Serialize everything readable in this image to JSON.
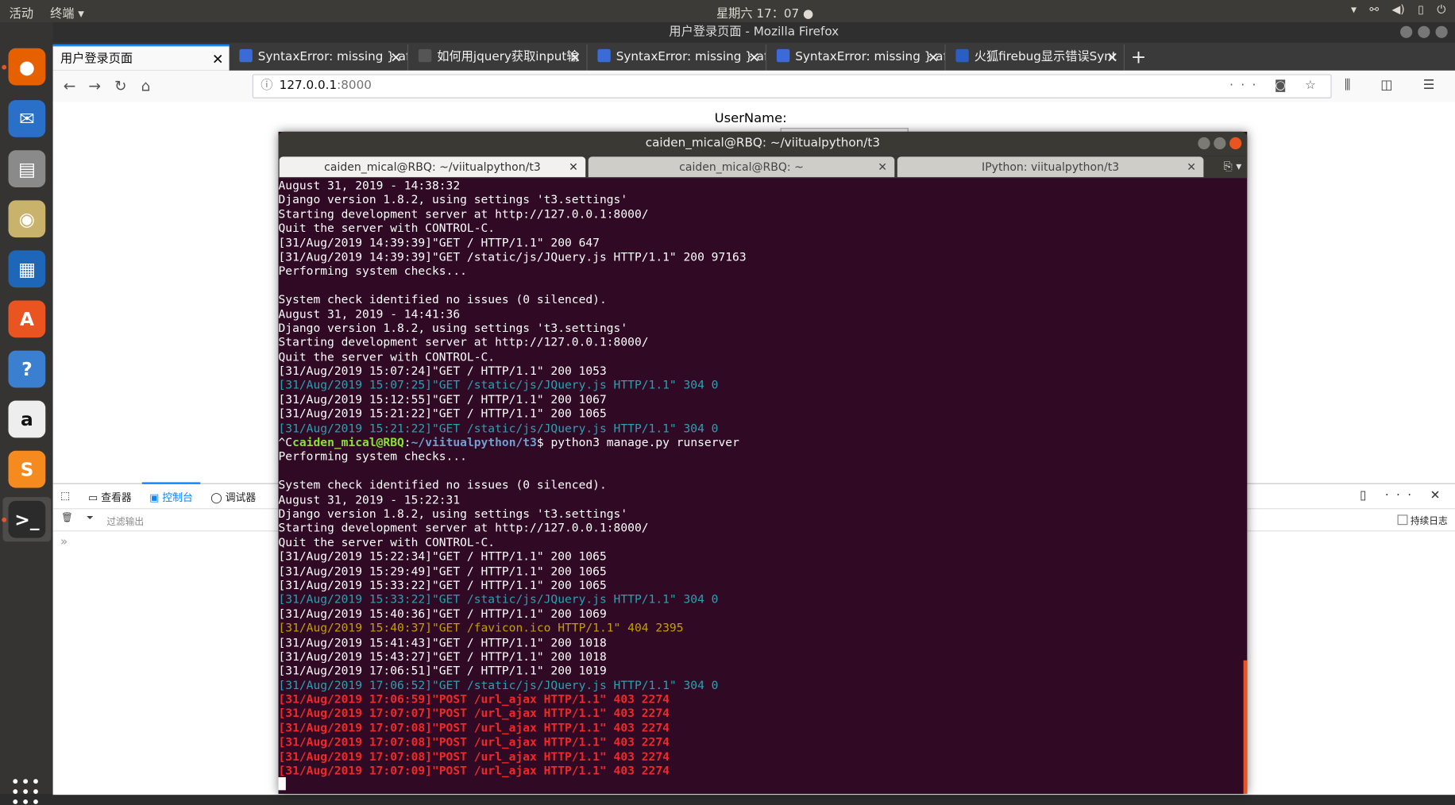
{
  "topbar": {
    "activities": "活动",
    "app_menu": "终端 ▾",
    "clock": "星期六 17：07 ●",
    "tray": [
      "▾",
      "⚯",
      "◀)",
      "▯",
      "⏻"
    ]
  },
  "firefox": {
    "window_title": "用户登录页面 - Mozilla Firefox",
    "tabs": [
      {
        "label": "用户登录页面"
      },
      {
        "label": "SyntaxError: missing } af"
      },
      {
        "label": "如何用jquery获取input输"
      },
      {
        "label": "SyntaxError: missing } af"
      },
      {
        "label": "SyntaxError: missing } af"
      },
      {
        "label": "火狐firebug显示错误Synt"
      }
    ],
    "newtab": "+",
    "url_host": "127.0.0.1",
    "url_port": ":8000",
    "nav": {
      "back": "←",
      "forward": "→",
      "reload": "↻",
      "home": "⌂",
      "info": "ⓘ",
      "page_actions": "··· ◙ ☆",
      "right": "⫼ ◫ ☰"
    }
  },
  "page": {
    "username_label": "UserName:"
  },
  "devtools": {
    "tabs": [
      "查看器",
      "控制台",
      "调试器"
    ],
    "filter_placeholder": "过滤输出",
    "persist_label": "持续日志",
    "chevron": "»",
    "right_icons": "▯ ··· ✕"
  },
  "terminal": {
    "title": "caiden_mical@RBQ: ~/viitualpython/t3",
    "tabs": [
      {
        "label": "caiden_mical@RBQ: ~/viitualpython/t3"
      },
      {
        "label": "caiden_mical@RBQ: ~"
      },
      {
        "label": "IPython: viitualpython/t3"
      }
    ],
    "lines": [
      {
        "t": "August 31, 2019 - 14:38:32",
        "c": ""
      },
      {
        "t": "Django version 1.8.2, using settings 't3.settings'",
        "c": ""
      },
      {
        "t": "Starting development server at http://127.0.0.1:8000/",
        "c": ""
      },
      {
        "t": "Quit the server with CONTROL-C.",
        "c": ""
      },
      {
        "t": "[31/Aug/2019 14:39:39]\"GET / HTTP/1.1\" 200 647",
        "c": ""
      },
      {
        "t": "[31/Aug/2019 14:39:39]\"GET /static/js/JQuery.js HTTP/1.1\" 200 97163",
        "c": ""
      },
      {
        "t": "Performing system checks...",
        "c": ""
      },
      {
        "t": "",
        "c": ""
      },
      {
        "t": "System check identified no issues (0 silenced).",
        "c": ""
      },
      {
        "t": "August 31, 2019 - 14:41:36",
        "c": ""
      },
      {
        "t": "Django version 1.8.2, using settings 't3.settings'",
        "c": ""
      },
      {
        "t": "Starting development server at http://127.0.0.1:8000/",
        "c": ""
      },
      {
        "t": "Quit the server with CONTROL-C.",
        "c": ""
      },
      {
        "t": "[31/Aug/2019 15:07:24]\"GET / HTTP/1.1\" 200 1053",
        "c": ""
      },
      {
        "t": "[31/Aug/2019 15:07:25]\"GET /static/js/JQuery.js HTTP/1.1\" 304 0",
        "c": "cyan"
      },
      {
        "t": "[31/Aug/2019 15:12:55]\"GET / HTTP/1.1\" 200 1067",
        "c": ""
      },
      {
        "t": "[31/Aug/2019 15:21:22]\"GET / HTTP/1.1\" 200 1065",
        "c": ""
      },
      {
        "t": "[31/Aug/2019 15:21:22]\"GET /static/js/JQuery.js HTTP/1.1\" 304 0",
        "c": "cyan"
      },
      {
        "t": "__PROMPT__",
        "c": ""
      },
      {
        "t": "Performing system checks...",
        "c": ""
      },
      {
        "t": "",
        "c": ""
      },
      {
        "t": "System check identified no issues (0 silenced).",
        "c": ""
      },
      {
        "t": "August 31, 2019 - 15:22:31",
        "c": ""
      },
      {
        "t": "Django version 1.8.2, using settings 't3.settings'",
        "c": ""
      },
      {
        "t": "Starting development server at http://127.0.0.1:8000/",
        "c": ""
      },
      {
        "t": "Quit the server with CONTROL-C.",
        "c": ""
      },
      {
        "t": "[31/Aug/2019 15:22:34]\"GET / HTTP/1.1\" 200 1065",
        "c": ""
      },
      {
        "t": "[31/Aug/2019 15:29:49]\"GET / HTTP/1.1\" 200 1065",
        "c": ""
      },
      {
        "t": "[31/Aug/2019 15:33:22]\"GET / HTTP/1.1\" 200 1065",
        "c": ""
      },
      {
        "t": "[31/Aug/2019 15:33:22]\"GET /static/js/JQuery.js HTTP/1.1\" 304 0",
        "c": "cyan"
      },
      {
        "t": "[31/Aug/2019 15:40:36]\"GET / HTTP/1.1\" 200 1069",
        "c": ""
      },
      {
        "t": "[31/Aug/2019 15:40:37]\"GET /favicon.ico HTTP/1.1\" 404 2395",
        "c": "yellow"
      },
      {
        "t": "[31/Aug/2019 15:41:43]\"GET / HTTP/1.1\" 200 1018",
        "c": ""
      },
      {
        "t": "[31/Aug/2019 15:43:27]\"GET / HTTP/1.1\" 200 1018",
        "c": ""
      },
      {
        "t": "[31/Aug/2019 17:06:51]\"GET / HTTP/1.1\" 200 1019",
        "c": ""
      },
      {
        "t": "[31/Aug/2019 17:06:52]\"GET /static/js/JQuery.js HTTP/1.1\" 304 0",
        "c": "cyan"
      },
      {
        "t": "[31/Aug/2019 17:06:59]\"POST /url_ajax HTTP/1.1\" 403 2274",
        "c": "red"
      },
      {
        "t": "[31/Aug/2019 17:07:07]\"POST /url_ajax HTTP/1.1\" 403 2274",
        "c": "red"
      },
      {
        "t": "[31/Aug/2019 17:07:08]\"POST /url_ajax HTTP/1.1\" 403 2274",
        "c": "red"
      },
      {
        "t": "[31/Aug/2019 17:07:08]\"POST /url_ajax HTTP/1.1\" 403 2274",
        "c": "red"
      },
      {
        "t": "[31/Aug/2019 17:07:08]\"POST /url_ajax HTTP/1.1\" 403 2274",
        "c": "red"
      },
      {
        "t": "[31/Aug/2019 17:07:09]\"POST /url_ajax HTTP/1.1\" 403 2274",
        "c": "red"
      }
    ],
    "prompt": {
      "prefix": "^C",
      "user": "caiden_mical@RBQ",
      "colon": ":",
      "path": "~/viitualpython/t3",
      "cmd": "$ python3 manage.py runserver"
    }
  },
  "dock": {
    "apps": [
      {
        "name": "firefox-icon",
        "glyph": "●",
        "color": "#e66000"
      },
      {
        "name": "thunderbird-icon",
        "glyph": "✉",
        "color": "#2a70c8"
      },
      {
        "name": "files-icon",
        "glyph": "▤",
        "color": "#8a8a8a"
      },
      {
        "name": "rhythmbox-icon",
        "glyph": "◉",
        "color": "#c9b26b"
      },
      {
        "name": "writer-icon",
        "glyph": "▦",
        "color": "#1e66b8"
      },
      {
        "name": "software-icon",
        "glyph": "A",
        "color": "#e95420"
      },
      {
        "name": "help-icon",
        "glyph": "?",
        "color": "#3b7fd1"
      },
      {
        "name": "amazon-icon",
        "glyph": "a",
        "color": "#eeeeee"
      },
      {
        "name": "sublime-icon",
        "glyph": "S",
        "color": "#f58b1f"
      },
      {
        "name": "terminal-icon",
        "glyph": ">_",
        "color": "#2b2b2b"
      }
    ]
  }
}
